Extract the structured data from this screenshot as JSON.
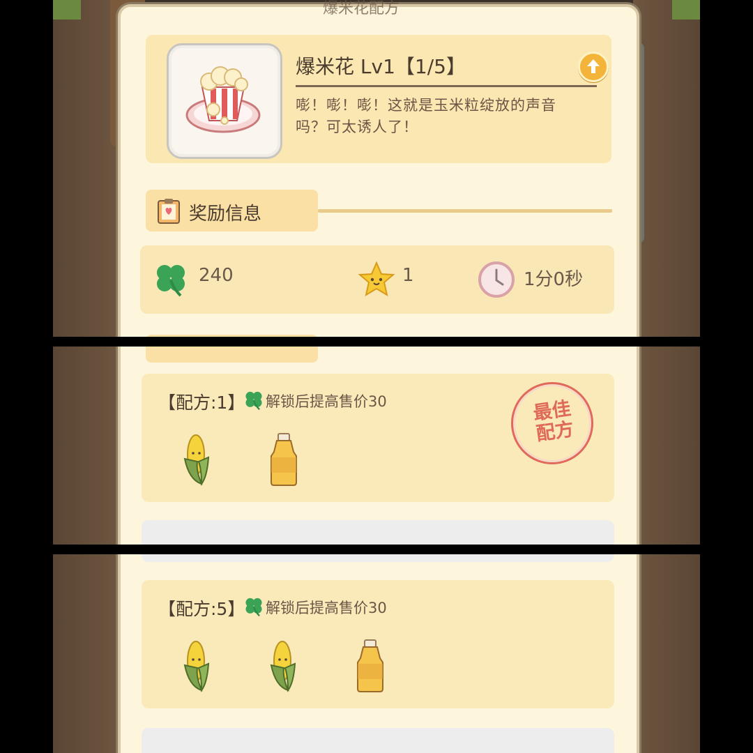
{
  "header_fragment": "爆米花配方",
  "item": {
    "name": "爆米花 Lv1【1/5】",
    "description": "嘭！嘭！嘭！这就是玉米粒绽放的声音吗？可太诱人了！",
    "icon": "popcorn-bucket-icon"
  },
  "reward_section": {
    "title": "奖励信息",
    "clover_value": "240",
    "star_value": "1",
    "time_value": "1分0秒"
  },
  "recipes": [
    {
      "label": "【配方:1】",
      "unlock_text": "解锁后提高售价30",
      "ingredients": [
        "corn-icon",
        "oil-bottle-icon"
      ],
      "best_stamp": "最佳配方"
    },
    {
      "label": "【配方:5】",
      "unlock_text": "解锁后提高售价30",
      "ingredients": [
        "corn-icon",
        "corn-icon",
        "oil-bottle-icon"
      ]
    }
  ],
  "colors": {
    "panel": "#fdf5dc",
    "card": "#fae7b1",
    "stamp": "#e06a5a",
    "clover": "#3aa356",
    "star": "#f7c934"
  }
}
